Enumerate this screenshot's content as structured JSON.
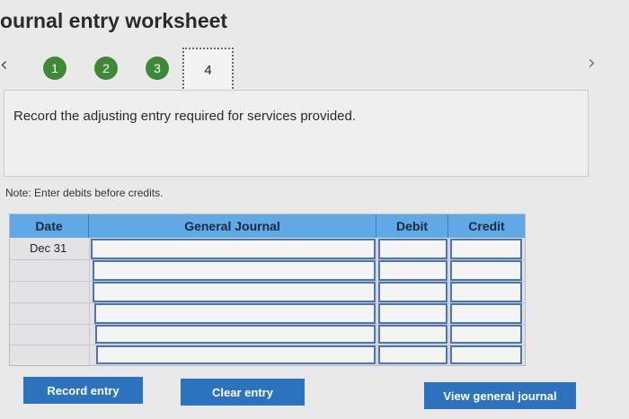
{
  "header": {
    "title": "ournal entry worksheet"
  },
  "nav": {
    "prev_glyph": "‹",
    "next_glyph": "›"
  },
  "steps": [
    "1",
    "2",
    "3",
    "4"
  ],
  "prompt": "Record the adjusting entry required for services provided.",
  "note": "Note: Enter debits before credits.",
  "journal": {
    "columns": [
      "Date",
      "General Journal",
      "Debit",
      "Credit"
    ],
    "rows": [
      {
        "date": "Dec 31"
      },
      {
        "date": ""
      },
      {
        "date": ""
      },
      {
        "date": ""
      },
      {
        "date": ""
      },
      {
        "date": ""
      }
    ]
  },
  "buttons": {
    "record": "Record entry",
    "clear": "Clear entry",
    "view": "View general journal"
  },
  "colors": {
    "step_complete": "#3d8a36",
    "header_bg": "#5fa9e6",
    "input_border": "#4a73b8",
    "button_bg": "#2c72bd"
  }
}
